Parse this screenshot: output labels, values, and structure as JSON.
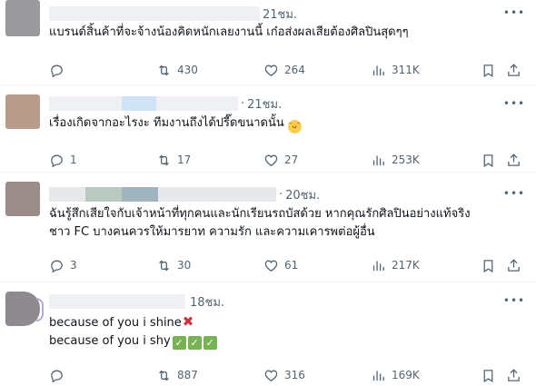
{
  "tweets": [
    {
      "time": "21ชม.",
      "lines": [
        "แบรนด์สิ้นค้าที่จะจ้างน้องคิดหนักเลยงานนี้  เก๋อส่งผลเสียต้องศิลปินสุดๆๆ"
      ],
      "replies": "",
      "retweets": "430",
      "likes": "264",
      "views": "311K"
    },
    {
      "time": "21ชม.",
      "lines": [
        "เรื่องเกิดจากอะไรงะ  ทีมงานถึงได้ปรี๊ดขนาดนั้น"
      ],
      "replies": "1",
      "retweets": "17",
      "likes": "27",
      "views": "253K"
    },
    {
      "time": "20ชม.",
      "lines": [
        "ฉันรู้สึกเสียใจกับเจ้าหน้าที่ทุกคนและนักเรียนรถบัสด้วย หากคุณรักศิลปินอย่างแท้จริง",
        "ชาว FC บางคนควรให้มารยาท ความรัก และความเคารพต่อผู้อื่น"
      ],
      "replies": "3",
      "retweets": "30",
      "likes": "61",
      "views": "217K"
    },
    {
      "time": "18ชม.",
      "lines": [
        "because of you i shine",
        "because of you i shy"
      ],
      "replies": "",
      "retweets": "887",
      "likes": "316",
      "views": "169K"
    }
  ],
  "icons": {
    "more": "more-icon",
    "reply": "reply-icon",
    "retweet": "retweet-icon",
    "like": "heart-icon",
    "views": "views-icon",
    "bookmark": "bookmark-icon",
    "share": "share-icon"
  },
  "colors": {
    "text": "#0f1419",
    "secondary": "#536471",
    "divider": "#eff3f4",
    "cross": "#d3303f",
    "check": "#77b255"
  }
}
